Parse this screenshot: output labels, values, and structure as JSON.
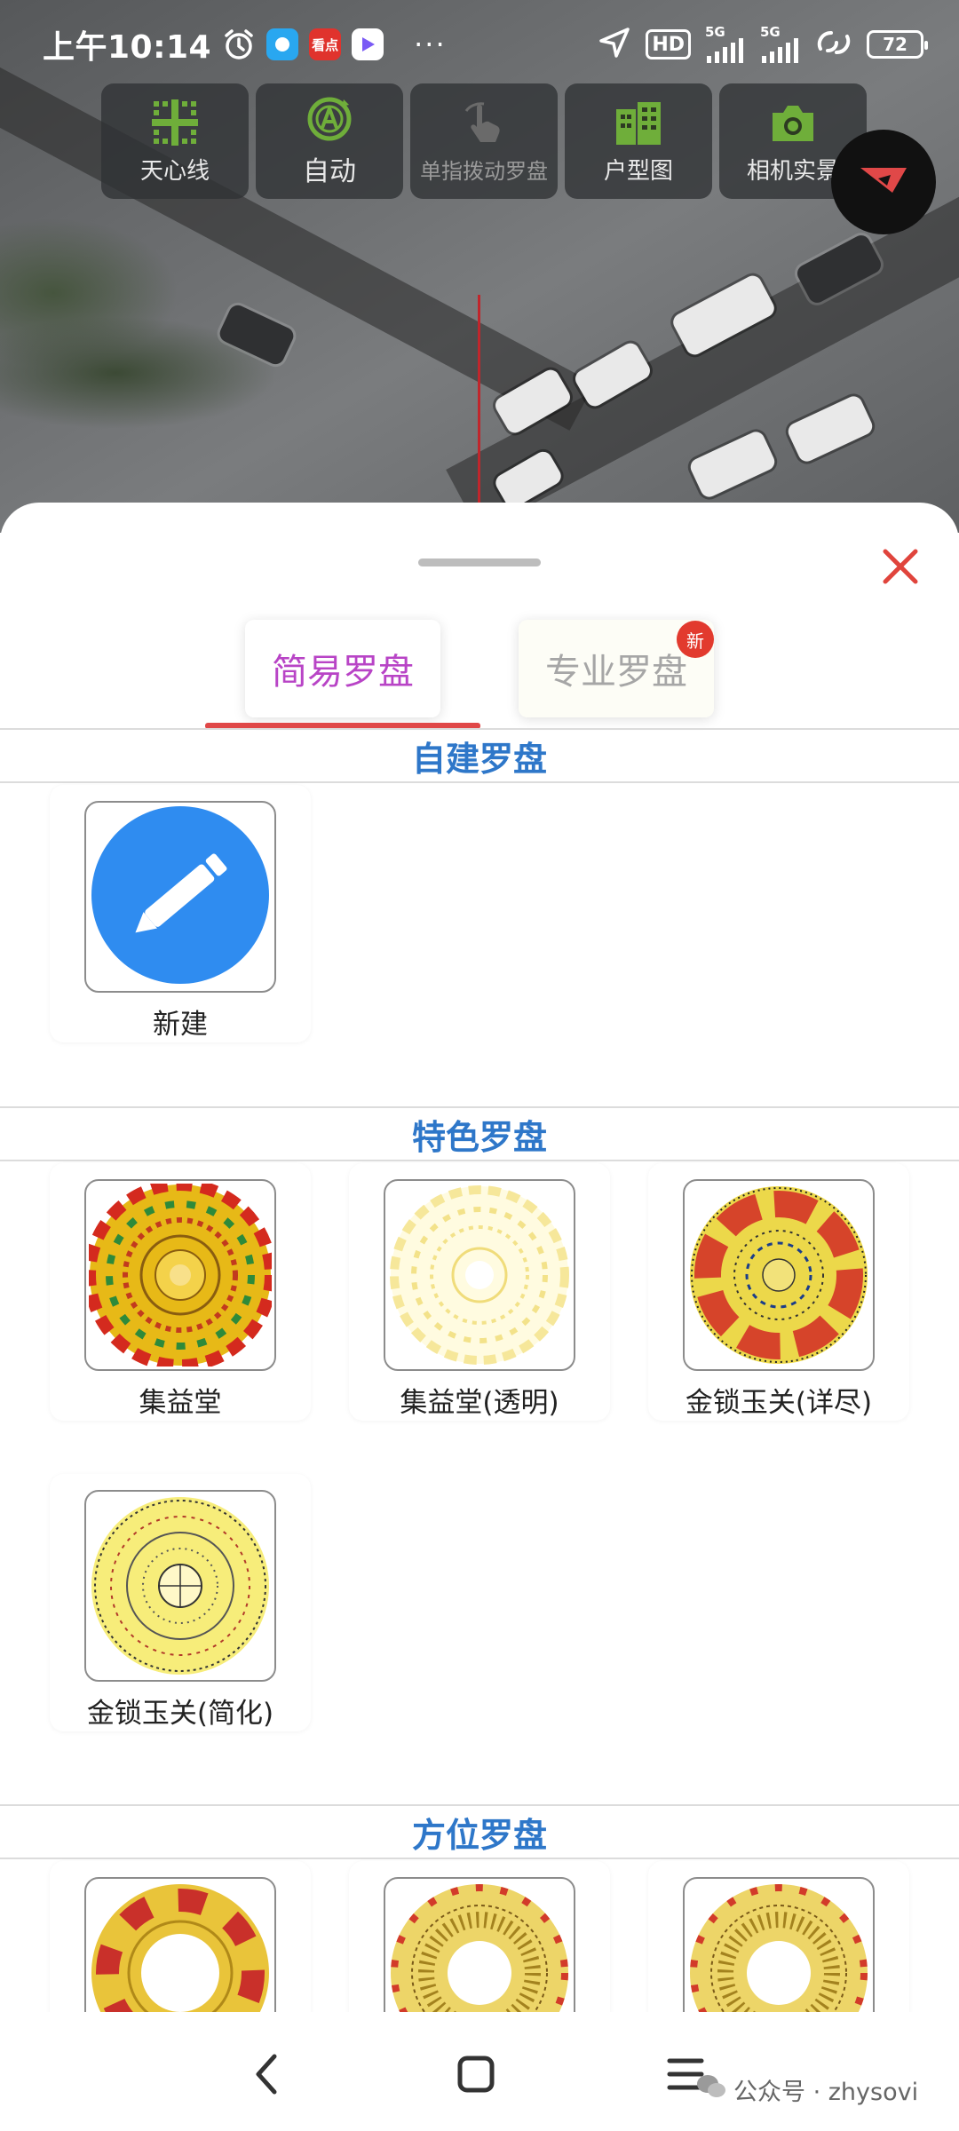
{
  "status_bar": {
    "time": "上午10:14",
    "app_badge_red": "看点",
    "more": "···",
    "hd": "HD",
    "net1": "5G",
    "net2": "5G",
    "battery": "72"
  },
  "toolbar": [
    {
      "label": "天心线",
      "icon": "grid-crosshair-icon"
    },
    {
      "label": "自动",
      "icon": "auto-a-icon"
    },
    {
      "label": "单指拨动罗盘",
      "icon": "hand-swipe-icon"
    },
    {
      "label": "户型图",
      "icon": "building-icon"
    },
    {
      "label": "相机实景",
      "icon": "camera-icon"
    }
  ],
  "tabs": {
    "simple": "简易罗盘",
    "pro": "专业罗盘",
    "new_badge": "新"
  },
  "sections": {
    "custom": {
      "title": "自建罗盘",
      "items": [
        {
          "label": "新建"
        }
      ]
    },
    "featured": {
      "title": "特色罗盘",
      "items": [
        {
          "label": "集益堂"
        },
        {
          "label": "集益堂(透明)"
        },
        {
          "label": "金锁玉关(详尽)"
        },
        {
          "label": "金锁玉关(简化)"
        }
      ]
    },
    "direction": {
      "title": "方位罗盘"
    }
  },
  "watermark": "公众号 · zhysovi",
  "colors": {
    "accent_purple": "#b844c6",
    "section_blue": "#2e77c9",
    "tab_underline": "#e04848",
    "close_red": "#e0443c",
    "new_button_blue": "#2f8cf0",
    "toolbar_icon_green": "#6fae3a"
  }
}
